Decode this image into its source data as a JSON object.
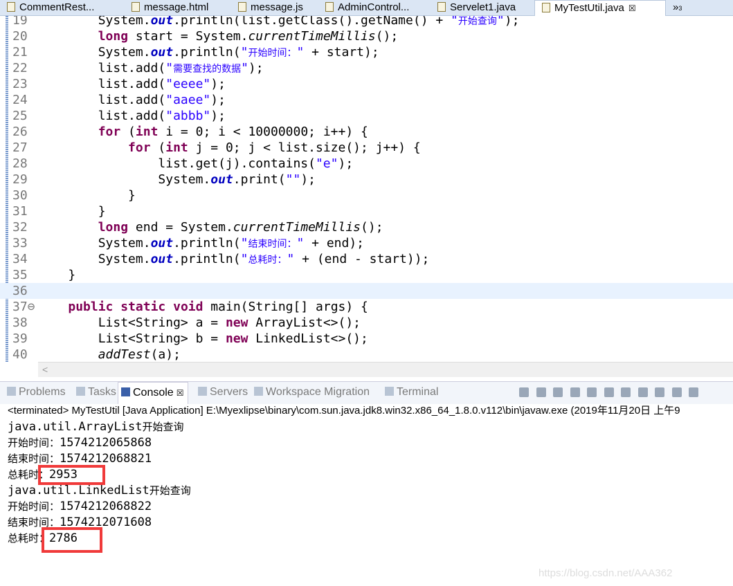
{
  "tabs": [
    {
      "label": "CommentRest...",
      "icon": "java-error-icon"
    },
    {
      "label": "message.html",
      "icon": "html-file-icon"
    },
    {
      "label": "message.js",
      "icon": "js-file-icon"
    },
    {
      "label": "AdminControl...",
      "icon": "java-error-icon"
    },
    {
      "label": "Servelet1.java",
      "icon": "java-file-icon"
    },
    {
      "label": "MyTestUtil.java",
      "icon": "java-file-icon",
      "active": true,
      "close": "☒"
    }
  ],
  "tab_overflow": {
    "label": "»",
    "count": "3"
  },
  "editor": {
    "current_line": 36,
    "lines": [
      {
        "n": "19",
        "t": [
          [
            "p",
            "        System."
          ],
          [
            "fld",
            "out"
          ],
          [
            "p",
            ".println(list.getClass().getName() + "
          ],
          [
            "str",
            "\""
          ],
          [
            "strcn",
            "开始查询"
          ],
          [
            "str",
            "\""
          ],
          [
            "p",
            ");"
          ]
        ]
      },
      {
        "n": "20",
        "t": [
          [
            "p",
            "        "
          ],
          [
            "kw",
            "long"
          ],
          [
            "p",
            " start = System."
          ],
          [
            "sm",
            "currentTimeMillis"
          ],
          [
            "p",
            "();"
          ]
        ]
      },
      {
        "n": "21",
        "t": [
          [
            "p",
            "        System."
          ],
          [
            "fld",
            "out"
          ],
          [
            "p",
            ".println("
          ],
          [
            "str",
            "\""
          ],
          [
            "strcn",
            "开始时间："
          ],
          [
            "str",
            "\""
          ],
          [
            "p",
            " + start);"
          ]
        ]
      },
      {
        "n": "22",
        "t": [
          [
            "p",
            "        list.add("
          ],
          [
            "str",
            "\""
          ],
          [
            "strcn",
            "需要查找的数据"
          ],
          [
            "str",
            "\""
          ],
          [
            "p",
            ");"
          ]
        ]
      },
      {
        "n": "23",
        "t": [
          [
            "p",
            "        list.add("
          ],
          [
            "str",
            "\"eeee\""
          ],
          [
            "p",
            ");"
          ]
        ]
      },
      {
        "n": "24",
        "t": [
          [
            "p",
            "        list.add("
          ],
          [
            "str",
            "\"aaee\""
          ],
          [
            "p",
            ");"
          ]
        ]
      },
      {
        "n": "25",
        "t": [
          [
            "p",
            "        list.add("
          ],
          [
            "str",
            "\"abbb\""
          ],
          [
            "p",
            ");"
          ]
        ]
      },
      {
        "n": "26",
        "t": [
          [
            "p",
            "        "
          ],
          [
            "kw",
            "for"
          ],
          [
            "p",
            " ("
          ],
          [
            "kw",
            "int"
          ],
          [
            "p",
            " i = 0; i < 10000000; i++) {"
          ]
        ]
      },
      {
        "n": "27",
        "t": [
          [
            "p",
            "            "
          ],
          [
            "kw",
            "for"
          ],
          [
            "p",
            " ("
          ],
          [
            "kw",
            "int"
          ],
          [
            "p",
            " j = 0; j < list.size(); j++) {"
          ]
        ]
      },
      {
        "n": "28",
        "t": [
          [
            "p",
            "                list.get(j).contains("
          ],
          [
            "str",
            "\"e\""
          ],
          [
            "p",
            ");"
          ]
        ]
      },
      {
        "n": "29",
        "t": [
          [
            "p",
            "                System."
          ],
          [
            "fld",
            "out"
          ],
          [
            "p",
            ".print("
          ],
          [
            "str",
            "\"\""
          ],
          [
            "p",
            ");"
          ]
        ]
      },
      {
        "n": "30",
        "t": [
          [
            "p",
            "            }"
          ]
        ]
      },
      {
        "n": "31",
        "t": [
          [
            "p",
            "        }"
          ]
        ]
      },
      {
        "n": "32",
        "t": [
          [
            "p",
            "        "
          ],
          [
            "kw",
            "long"
          ],
          [
            "p",
            " end = System."
          ],
          [
            "sm",
            "currentTimeMillis"
          ],
          [
            "p",
            "();"
          ]
        ]
      },
      {
        "n": "33",
        "t": [
          [
            "p",
            "        System."
          ],
          [
            "fld",
            "out"
          ],
          [
            "p",
            ".println("
          ],
          [
            "str",
            "\""
          ],
          [
            "strcn",
            "结束时间："
          ],
          [
            "str",
            "\""
          ],
          [
            "p",
            " + end);"
          ]
        ]
      },
      {
        "n": "34",
        "t": [
          [
            "p",
            "        System."
          ],
          [
            "fld",
            "out"
          ],
          [
            "p",
            ".println("
          ],
          [
            "str",
            "\""
          ],
          [
            "strcn",
            "总耗时："
          ],
          [
            "str",
            "\""
          ],
          [
            "p",
            " + (end - start));"
          ]
        ]
      },
      {
        "n": "35",
        "t": [
          [
            "p",
            "    }"
          ]
        ]
      },
      {
        "n": "36",
        "t": [
          [
            "p",
            ""
          ]
        ]
      },
      {
        "n": "37⊖",
        "t": [
          [
            "p",
            "    "
          ],
          [
            "kw",
            "public"
          ],
          [
            "p",
            " "
          ],
          [
            "kw",
            "static"
          ],
          [
            "p",
            " "
          ],
          [
            "kw",
            "void"
          ],
          [
            "p",
            " main(String[] args) {"
          ]
        ]
      },
      {
        "n": "38",
        "t": [
          [
            "p",
            "        List<String> a = "
          ],
          [
            "kw",
            "new"
          ],
          [
            "p",
            " ArrayList<>();"
          ]
        ]
      },
      {
        "n": "39",
        "t": [
          [
            "p",
            "        List<String> b = "
          ],
          [
            "kw",
            "new"
          ],
          [
            "p",
            " LinkedList<>();"
          ]
        ]
      },
      {
        "n": "40",
        "t": [
          [
            "p",
            "        "
          ],
          [
            "sm",
            "addTest"
          ],
          [
            "p",
            "(a);"
          ]
        ]
      }
    ],
    "hscroll_arrow": "<"
  },
  "panel": {
    "tabs": [
      {
        "label": "Problems",
        "icon": "problems-icon"
      },
      {
        "label": "Tasks",
        "icon": "tasks-icon"
      },
      {
        "label": "Console",
        "icon": "console-icon",
        "active": true,
        "close": "☒"
      },
      {
        "label": "Servers",
        "icon": "servers-icon"
      },
      {
        "label": "Workspace Migration",
        "icon": "migration-icon"
      },
      {
        "label": "Terminal",
        "icon": "terminal-icon"
      }
    ]
  },
  "console": {
    "status": "<terminated> MyTestUtil [Java Application] E:\\Myexlipse\\binary\\com.sun.java.jdk8.win32.x86_64_1.8.0.v112\\bin\\javaw.exe (2019年11月20日 上午9",
    "output": [
      [
        [
          "m",
          "java.util.ArrayList"
        ],
        [
          "c",
          "开始查询"
        ]
      ],
      [
        [
          "c",
          "开始时间："
        ],
        [
          "m",
          "1574212065868"
        ]
      ],
      [
        [
          "c",
          "结束时间："
        ],
        [
          "m",
          "1574212068821"
        ]
      ],
      [
        [
          "c",
          "总耗时："
        ],
        [
          "m",
          "2953"
        ]
      ],
      [
        [
          "m",
          "java.util.LinkedList"
        ],
        [
          "c",
          "开始查询"
        ]
      ],
      [
        [
          "c",
          "开始时间："
        ],
        [
          "m",
          "1574212068822"
        ]
      ],
      [
        [
          "c",
          "结束时间："
        ],
        [
          "m",
          "1574212071608"
        ]
      ],
      [
        [
          "c",
          "总耗时："
        ],
        [
          "m",
          "2786"
        ]
      ]
    ],
    "highlight_color": "#f03a3a"
  },
  "watermark": "https://blog.csdn.net/AAA362"
}
